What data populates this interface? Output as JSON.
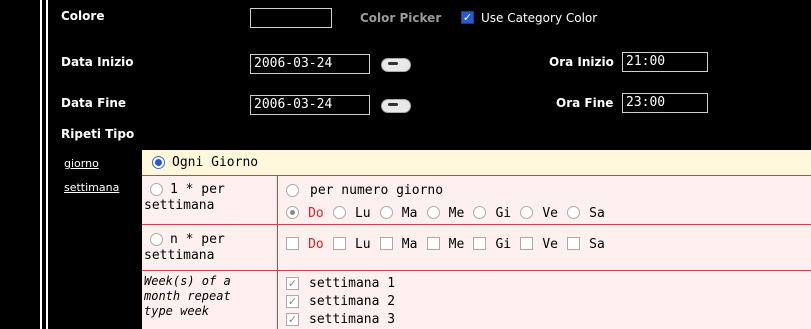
{
  "labels": {
    "colore": "Colore",
    "data_inizio": "Data Inizio",
    "data_fine": "Data Fine",
    "ripeti_tipo": "Ripeti Tipo",
    "ora_inizio": "Ora Inizio",
    "ora_fine": "Ora Fine",
    "color_picker": "Color Picker",
    "use_category_color": "Use Category Color"
  },
  "fields": {
    "colore": "",
    "data_inizio": "2006-03-24",
    "data_fine": "2006-03-24",
    "ora_inizio": "21:00",
    "ora_fine": "23:00"
  },
  "links": {
    "giorno": "giorno",
    "settimana": "settimana"
  },
  "repeat": {
    "ogni_giorno": "Ogni Giorno",
    "one_per_week_1": "1 * per",
    "one_per_week_2": "settimana",
    "per_numero_giorno": "per numero giorno",
    "n_per_week_1": "n * per",
    "n_per_week_2": "settimana",
    "week_of_month_1": "Week(s) of a",
    "week_of_month_2": "month repeat",
    "week_of_month_3": "type week",
    "days": [
      "Do",
      "Lu",
      "Ma",
      "Me",
      "Gi",
      "Ve",
      "Sa"
    ],
    "weeks": [
      "settimana 1",
      "settimana 2",
      "settimana 3"
    ]
  },
  "colors": {
    "accent": "#2a5ad0",
    "highlight_day": "#dd2222",
    "border": "#cc4444",
    "top_row_bg": "#fff8dc",
    "cell_bg": "#fff0f0"
  }
}
